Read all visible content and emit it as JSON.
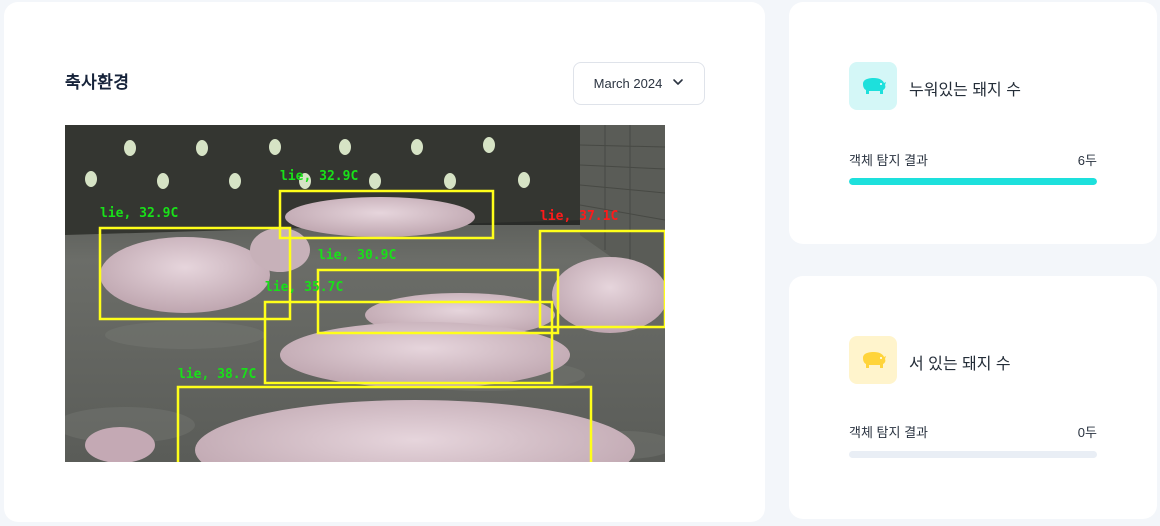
{
  "main": {
    "title": "축사환경",
    "month_select": {
      "value": "March 2024"
    },
    "detections": [
      {
        "label": "lie, 32.9C",
        "status": "normal"
      },
      {
        "label": "lie, 32.9C",
        "status": "normal"
      },
      {
        "label": "lie, 37.1C",
        "status": "alert"
      },
      {
        "label": "lie, 30.9C",
        "status": "normal"
      },
      {
        "label": "lie, 35.7C",
        "status": "normal"
      },
      {
        "label": "lie, 38.7C",
        "status": "normal"
      }
    ]
  },
  "lying": {
    "title": "누워있는 돼지 수",
    "result_label": "객체 탐지 결과",
    "result_value": "6두",
    "fill_fraction": 1.0,
    "icon": "pig-icon",
    "icon_bg": "#d4f7f7",
    "accent": "#1de0dc"
  },
  "standing": {
    "title": "서 있는 돼지 수",
    "result_label": "객체 탐지 결과",
    "result_value": "0두",
    "fill_fraction": 0.0,
    "icon": "pig-icon",
    "icon_bg": "#fff4cc",
    "accent": "#ffd43b"
  },
  "colors": {
    "box": "#ffff1a",
    "normal_label": "#19e019",
    "alert_label": "#ff1a1a"
  }
}
